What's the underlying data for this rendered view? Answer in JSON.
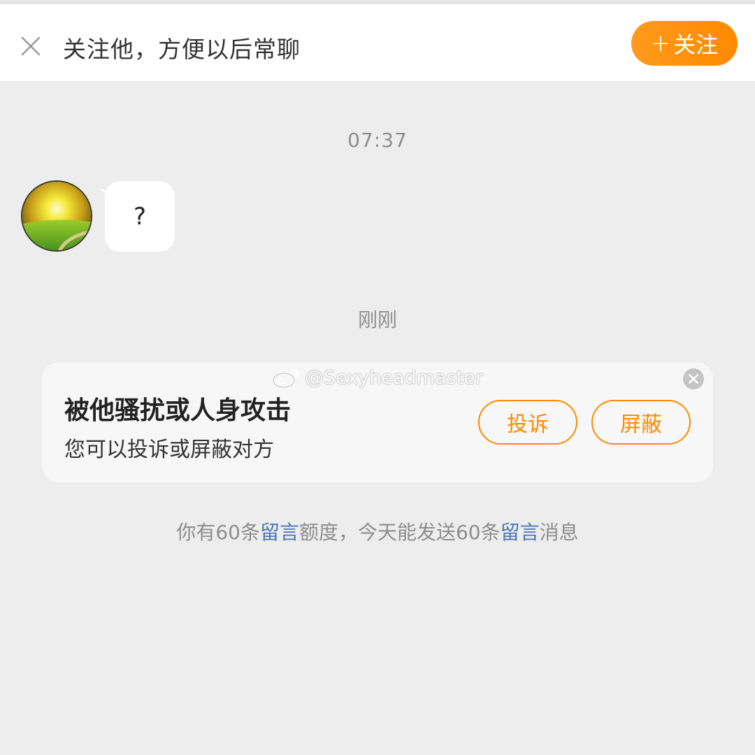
{
  "follow_bar": {
    "prompt": "关注他，方便以后常聊",
    "follow_plus": "+",
    "follow_label": "关注"
  },
  "messages": [
    {
      "time": "07:37",
      "sender": "other",
      "text": "?"
    }
  ],
  "system_time": "刚刚",
  "report_card": {
    "title": "被他骚扰或人身攻击",
    "subtitle": "您可以投诉或屏蔽对方",
    "report_label": "投诉",
    "block_label": "屏蔽"
  },
  "watermark": "@Sexyheadmaster",
  "quota": {
    "part1": "你有60条",
    "link1": "留言",
    "part2": "额度，今天能发送60条",
    "link2": "留言",
    "part3": "消息"
  },
  "colors": {
    "accent": "#ff8a00",
    "link": "#4a76b8",
    "background": "#ededed"
  },
  "icons": {
    "close": "close-icon",
    "card_close": "close-circle-icon",
    "watermark_logo": "weibo-logo-icon"
  }
}
